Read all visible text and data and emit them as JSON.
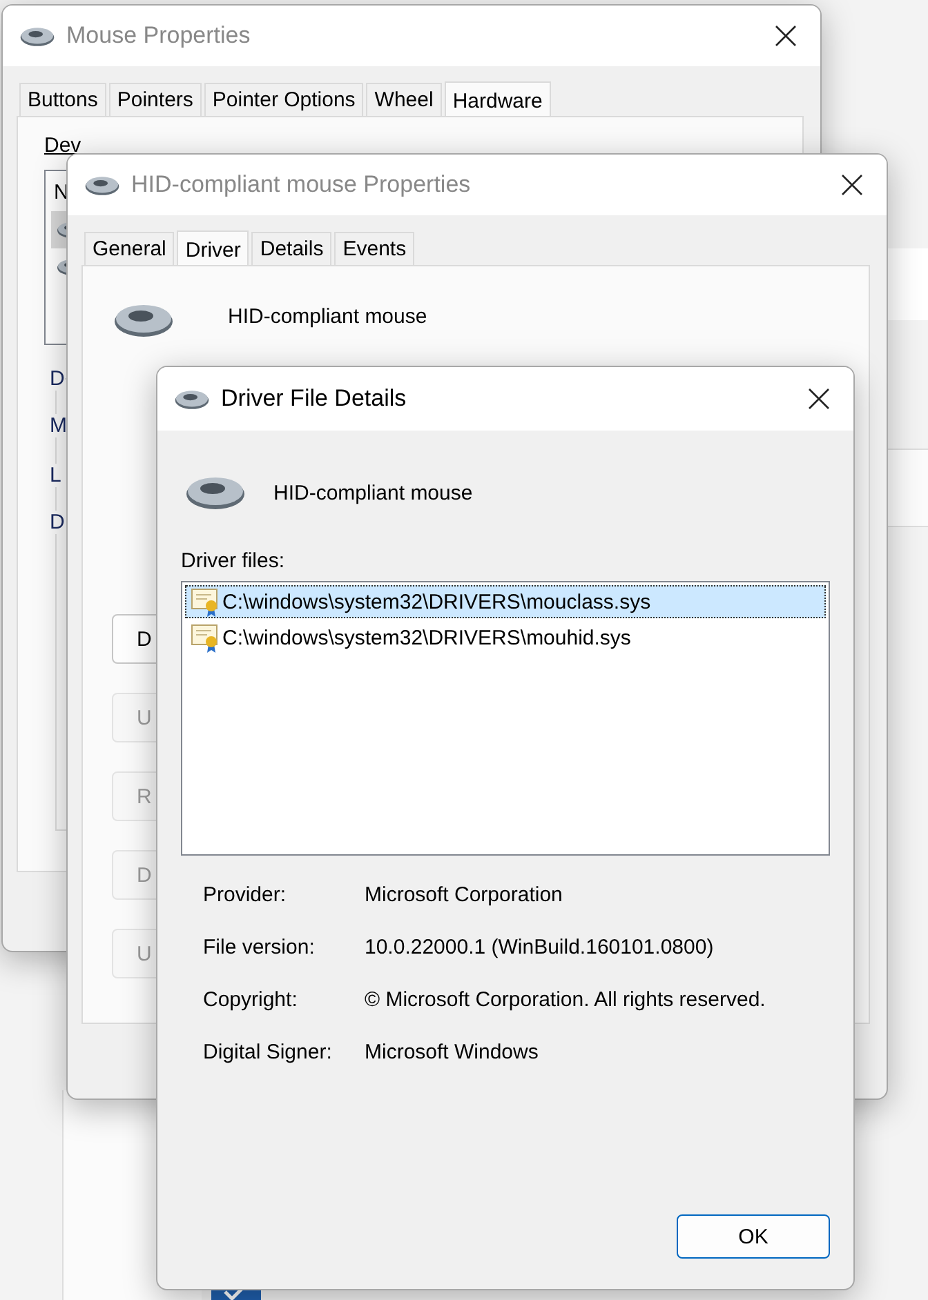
{
  "background": {
    "checkbox": {
      "checked": true
    }
  },
  "windows": [
    {
      "kind": "mouse",
      "title": "Mouse Properties",
      "active": false,
      "tabs": [
        {
          "label": "Buttons",
          "selected": false
        },
        {
          "label": "Pointers",
          "selected": false
        },
        {
          "label": "Pointer Options",
          "selected": false
        },
        {
          "label": "Wheel",
          "selected": false
        },
        {
          "label": "Hardware",
          "selected": true
        }
      ],
      "devices_label": "Dev",
      "list_header": "N",
      "device_rows": [
        {
          "selected": true
        },
        {
          "selected": false
        }
      ],
      "group_letters": [
        "D",
        "M",
        "L",
        "D"
      ]
    },
    {
      "kind": "hid",
      "title": "HID-compliant mouse Properties",
      "active": false,
      "tabs": [
        {
          "label": "General",
          "selected": false
        },
        {
          "label": "Driver",
          "selected": true
        },
        {
          "label": "Details",
          "selected": false
        },
        {
          "label": "Events",
          "selected": false
        }
      ],
      "device_name": "HID-compliant mouse",
      "buttons": [
        {
          "label": "D",
          "disabled": false
        },
        {
          "label": "U",
          "disabled": true
        },
        {
          "label": "R",
          "disabled": true
        },
        {
          "label": "D",
          "disabled": true
        },
        {
          "label": "U",
          "disabled": true
        }
      ]
    },
    {
      "kind": "details",
      "title": "Driver File Details",
      "active": true,
      "device_name": "HID-compliant mouse",
      "files_label": "Driver files:",
      "files": [
        {
          "path": "C:\\windows\\system32\\DRIVERS\\mouclass.sys",
          "selected": true
        },
        {
          "path": "C:\\windows\\system32\\DRIVERS\\mouhid.sys",
          "selected": false
        }
      ],
      "properties": [
        {
          "label": "Provider:",
          "value": "Microsoft Corporation"
        },
        {
          "label": "File version:",
          "value": "10.0.22000.1 (WinBuild.160101.0800)"
        },
        {
          "label": "Copyright:",
          "value": "© Microsoft Corporation. All rights reserved."
        },
        {
          "label": "Digital Signer:",
          "value": "Microsoft Windows"
        }
      ],
      "buttons": [
        "OK"
      ]
    }
  ]
}
